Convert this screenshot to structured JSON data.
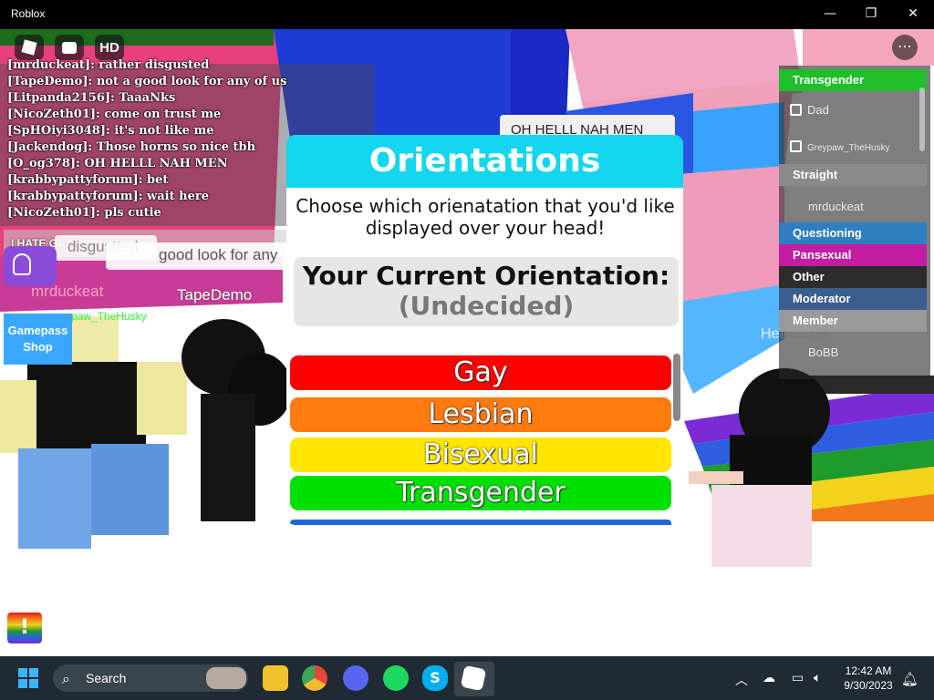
{
  "window": {
    "title": "Roblox",
    "minimize_glyph": "—",
    "restore_glyph": "❐",
    "close_glyph": "✕"
  },
  "topbar": {
    "chat_icon": "chat-icon",
    "hd_label": "HD"
  },
  "chat": {
    "messages": [
      {
        "user": "[mrduckeat]:",
        "text": "rather disgusted"
      },
      {
        "user": "[TapeDemo]:",
        "text": "not a good look for any of us"
      },
      {
        "user": "[Litpanda2156]:",
        "text": "TaaaNks"
      },
      {
        "user": "[NicoZeth01]:",
        "text": "come on trust me"
      },
      {
        "user": "[SpHOiyi3048]:",
        "text": "it's not like me"
      },
      {
        "user": "[Jackendog]:",
        "text": "Those horns so nice tbh"
      },
      {
        "user": "[O_og378]:",
        "text": "OH HELLL NAH MEN"
      },
      {
        "user": "[krabbypattyforum]:",
        "text": "bet"
      },
      {
        "user": "[krabbypattyforum]:",
        "text": "wait here"
      },
      {
        "user": "[NicoZeth01]:",
        "text": "pls cutie"
      }
    ],
    "input_value": "I HATE GAY"
  },
  "overhead": {
    "bubble_1": "disgustted",
    "bubble_2": "good look for any",
    "name_1": "mrduckeat",
    "name_2": "TapeDemo",
    "name_3": "paw_TheHusky",
    "name_4": "Headache",
    "speech": "OH HELLL NAH MEN"
  },
  "gamepass": {
    "line1": "Gamepass",
    "line2": "Shop"
  },
  "modal": {
    "title": "Orientations",
    "description": "Choose which orienatation that you'd like displayed over your head!",
    "current_label": "Your Current Orientation:",
    "current_value": "(Undecided)",
    "options": [
      {
        "label": "Gay",
        "color": "#ff0000"
      },
      {
        "label": "Lesbian",
        "color": "#ff7b0f"
      },
      {
        "label": "Bisexual",
        "color": "#ffe600"
      },
      {
        "label": "Transgender",
        "color": "#00e000"
      }
    ]
  },
  "player_list": {
    "rows": [
      {
        "label": "Transgender",
        "color": "#1fbf2a",
        "kind": "team"
      },
      {
        "label": "Dad",
        "kind": "player",
        "premium": true
      },
      {
        "label": "Greypaw_TheHusky",
        "kind": "player",
        "premium": true
      },
      {
        "label": "Straight",
        "color": "#8a8a8a",
        "kind": "team"
      },
      {
        "label": "mrduckeat",
        "kind": "player",
        "premium": false
      },
      {
        "label": "Questioning",
        "color": "#2f7fc0",
        "kind": "team"
      },
      {
        "label": "Pansexual",
        "color": "#c21da3",
        "kind": "team"
      },
      {
        "label": "Other",
        "color": "#2c2c2c",
        "kind": "team"
      },
      {
        "label": "Moderator",
        "color": "#3a5e8e",
        "kind": "team"
      },
      {
        "label": "Member",
        "color": "#9a9a9a",
        "kind": "team"
      },
      {
        "label": "BoBB",
        "kind": "player",
        "premium": false
      }
    ]
  },
  "taskbar": {
    "search_label": "Search",
    "apps": [
      "windows-start-icon",
      "file-explorer-icon",
      "chrome-icon",
      "discord-icon",
      "spotify-icon",
      "skype-icon",
      "roblox-icon"
    ],
    "time": "12:42 AM",
    "date": "9/30/2023"
  }
}
